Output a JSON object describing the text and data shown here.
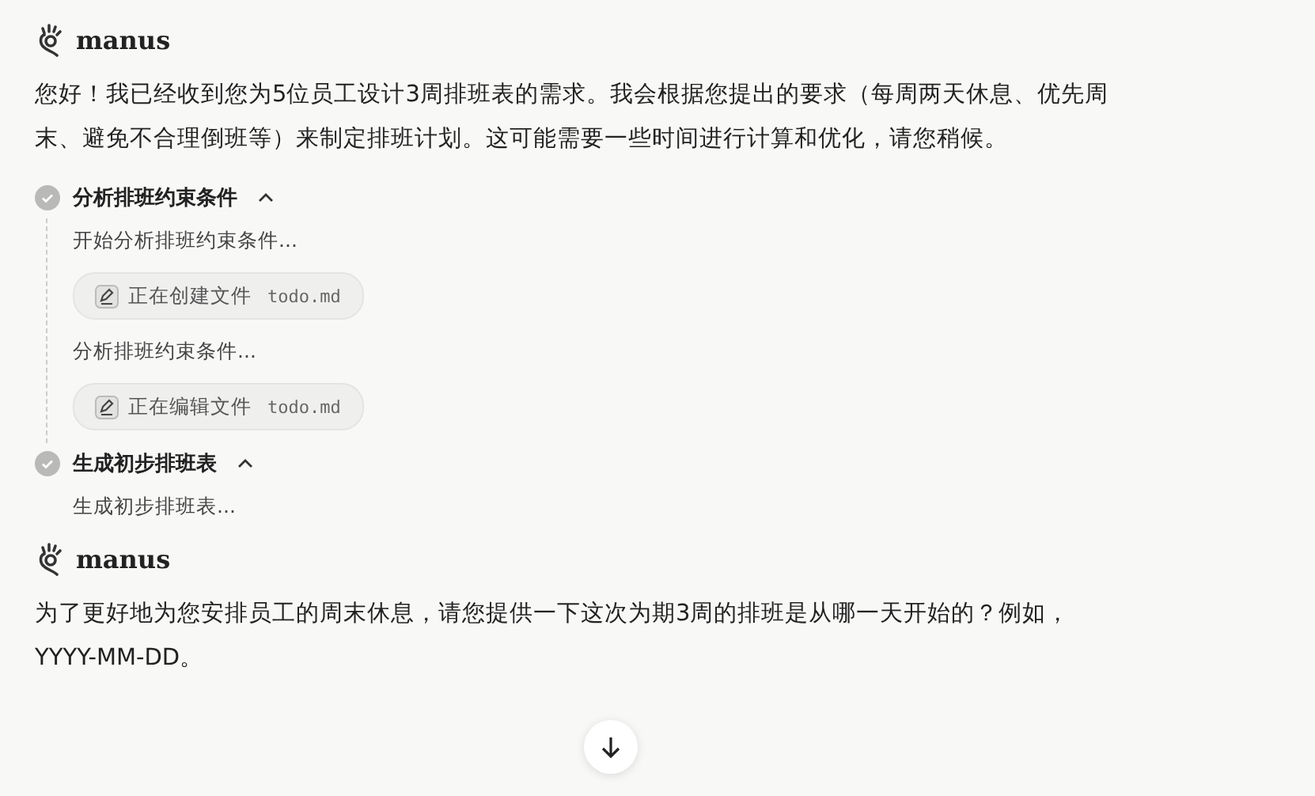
{
  "blocks": [
    {
      "kind": "sender",
      "name": "manus"
    },
    {
      "kind": "text",
      "text": "您好！我已经收到您为5位员工设计3周排班表的需求。我会根据您提出的要求（每周两天休息、优先周末、避免不合理倒班等）来制定排班计划。这可能需要一些时间进行计算和优化，请您稍候。"
    },
    {
      "kind": "step",
      "title": "分析排班约束条件",
      "done": true,
      "expanded": true,
      "children": [
        {
          "kind": "note",
          "text": "开始分析排班约束条件..."
        },
        {
          "kind": "file",
          "action": "正在创建文件",
          "file": "todo.md"
        },
        {
          "kind": "note",
          "text": "分析排班约束条件..."
        },
        {
          "kind": "file",
          "action": "正在编辑文件",
          "file": "todo.md"
        }
      ]
    },
    {
      "kind": "step",
      "title": "生成初步排班表",
      "done": true,
      "expanded": true,
      "children": [
        {
          "kind": "note",
          "text": "生成初步排班表..."
        }
      ]
    },
    {
      "kind": "sender",
      "name": "manus"
    },
    {
      "kind": "text",
      "text": "为了更好地为您安排员工的周末休息，请您提供一下这次为期3周的排班是从哪一天开始的？例如，\nYYYY-MM-DD。"
    }
  ]
}
